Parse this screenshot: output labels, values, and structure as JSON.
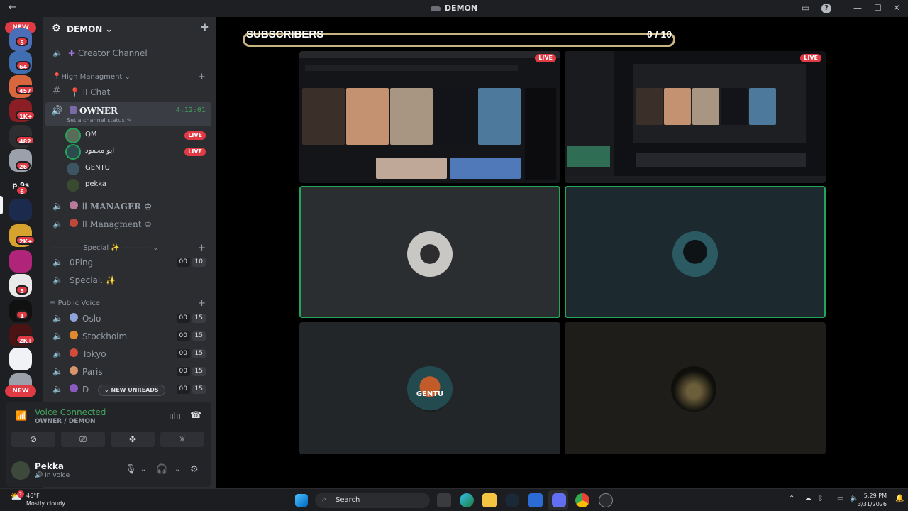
{
  "titlebar": {
    "back_icon": "back-arrow-icon",
    "title": "DEMON"
  },
  "rail": {
    "new_top": "NEW",
    "new_bottom": "NEW",
    "badges": [
      "5",
      "64",
      "457",
      "1K+",
      "482",
      "26",
      "6",
      "2K+",
      "5",
      "1",
      "2K+"
    ],
    "server_initials": [
      "p.9s"
    ]
  },
  "server": {
    "name": "DEMON",
    "chevron": "⌄"
  },
  "channels": {
    "creator": "Creator Channel",
    "cat_high": "High Managment",
    "chat": "اا Chat",
    "owner": "OWNER",
    "owner_time": "4:12:01",
    "owner_status": "Set a channel status",
    "users": [
      {
        "name": "QM",
        "live": "LIVE"
      },
      {
        "name": "ابو محمود",
        "live": "LIVE"
      },
      {
        "name": "GENTU",
        "live": ""
      },
      {
        "name": "pekka",
        "live": ""
      }
    ],
    "manager": "اا MANAGER",
    "managment": "اا Managment",
    "cat_special": "———— Special ✨ ————",
    "oping": "0Ping",
    "oping_counts": [
      "00",
      "10"
    ],
    "special": "Special. ✨",
    "cat_public": "Public Voice",
    "public": [
      {
        "name": "Oslo",
        "counts": [
          "00",
          "15"
        ]
      },
      {
        "name": "Stockholm",
        "counts": [
          "00",
          "15"
        ]
      },
      {
        "name": "Tokyo",
        "counts": [
          "00",
          "15"
        ]
      },
      {
        "name": "Paris",
        "counts": [
          "00",
          "15"
        ]
      },
      {
        "name": "D",
        "counts": [
          "00",
          "15"
        ]
      }
    ],
    "new_unreads": "NEW UNREADS"
  },
  "voice": {
    "connected": "Voice Connected",
    "location": "OWNER / DEMON"
  },
  "user": {
    "name": "Pekka",
    "status": "In voice"
  },
  "stage": {
    "subscribers_label": "SUBSCRIBERS",
    "subscribers_count": "0 / 10",
    "subscribers_progress": 0,
    "tiles": [
      {
        "kind": "stream",
        "live": "LIVE"
      },
      {
        "kind": "stream",
        "live": "LIVE"
      },
      {
        "kind": "avatar",
        "speaking": true
      },
      {
        "kind": "avatar",
        "speaking": true
      },
      {
        "kind": "avatar",
        "speaking": false
      },
      {
        "kind": "avatar",
        "speaking": false
      }
    ],
    "gentu_logo_text": "GENTU"
  },
  "taskbar": {
    "temperature": "46°F",
    "condition": "Mostly cloudy",
    "search_placeholder": "Search",
    "time": "5:29 PM",
    "date": "3/31/2026"
  },
  "colors": {
    "accent_green": "#23a55a",
    "live_red": "#e03a44",
    "progress_border": "#c9b484"
  }
}
